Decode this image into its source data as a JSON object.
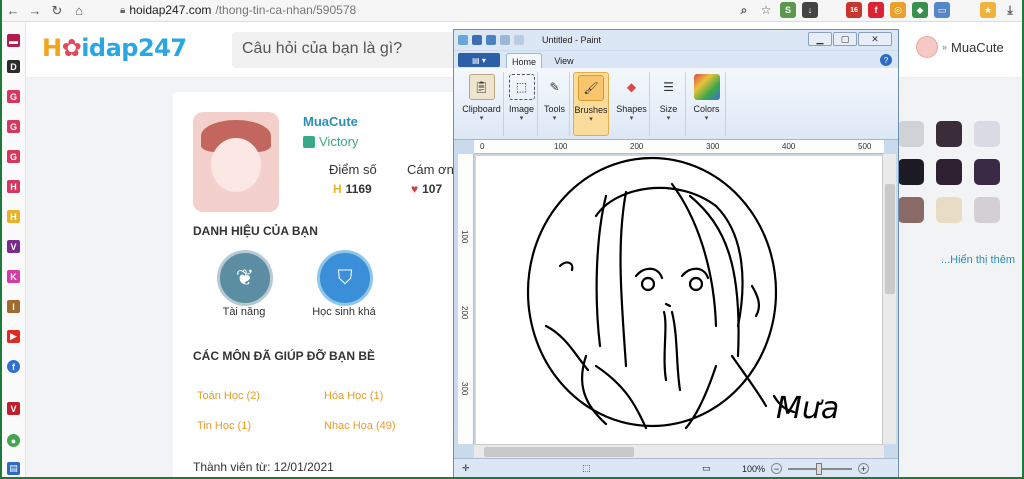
{
  "browser": {
    "url_host": "hoidap247.com",
    "url_path": "/thong-tin-ca-nhan/590578",
    "extension_badge": "16"
  },
  "bookmarks": [
    "D",
    "G",
    "G",
    "G",
    "H",
    "V",
    "K",
    "I"
  ],
  "site": {
    "logo": "Hoidap247",
    "search_placeholder": "Câu hỏi của bạn là gì?",
    "current_user": "MuaCute"
  },
  "profile": {
    "name": "MuaCute",
    "rank": "Victory",
    "score_label": "Điểm số",
    "score_value": "1169",
    "thanks_label": "Cám ơn",
    "thanks_value": "107",
    "titles_heading": "DANH HIỆU CỦA BẠN",
    "badges": [
      {
        "label": "Tài năng"
      },
      {
        "label": "Học sinh khá"
      }
    ],
    "subjects_heading": "CÁC MÔN ĐÃ GIÚP ĐỠ BẠN BÈ",
    "subjects": [
      {
        "label": "Toán Học (2)"
      },
      {
        "label": "Hóa Học (1)"
      },
      {
        "label": "Tin Học (1)"
      },
      {
        "label": "Nhạc Họa (49)"
      }
    ],
    "member_since": "Thành viên từ: 12/01/2021"
  },
  "sidebar_right": {
    "show_more": "...Hiển thị thêm"
  },
  "paint": {
    "title": "Untitled - Paint",
    "tabs": [
      "Home",
      "View"
    ],
    "groups": [
      "Clipboard",
      "Image",
      "Tools",
      "Brushes",
      "Shapes",
      "Size",
      "Colors"
    ],
    "ruler_h": [
      "100",
      "200",
      "300",
      "400",
      "500"
    ],
    "ruler_v": [
      "100",
      "200",
      "300"
    ],
    "zoom": "100%",
    "signature": "Mưa"
  },
  "colors": {
    "brand_blue": "#2aa7e0",
    "brand_orange": "#f2a41c",
    "subject_orange": "#e59c28",
    "rank_green": "#3aa98a"
  }
}
